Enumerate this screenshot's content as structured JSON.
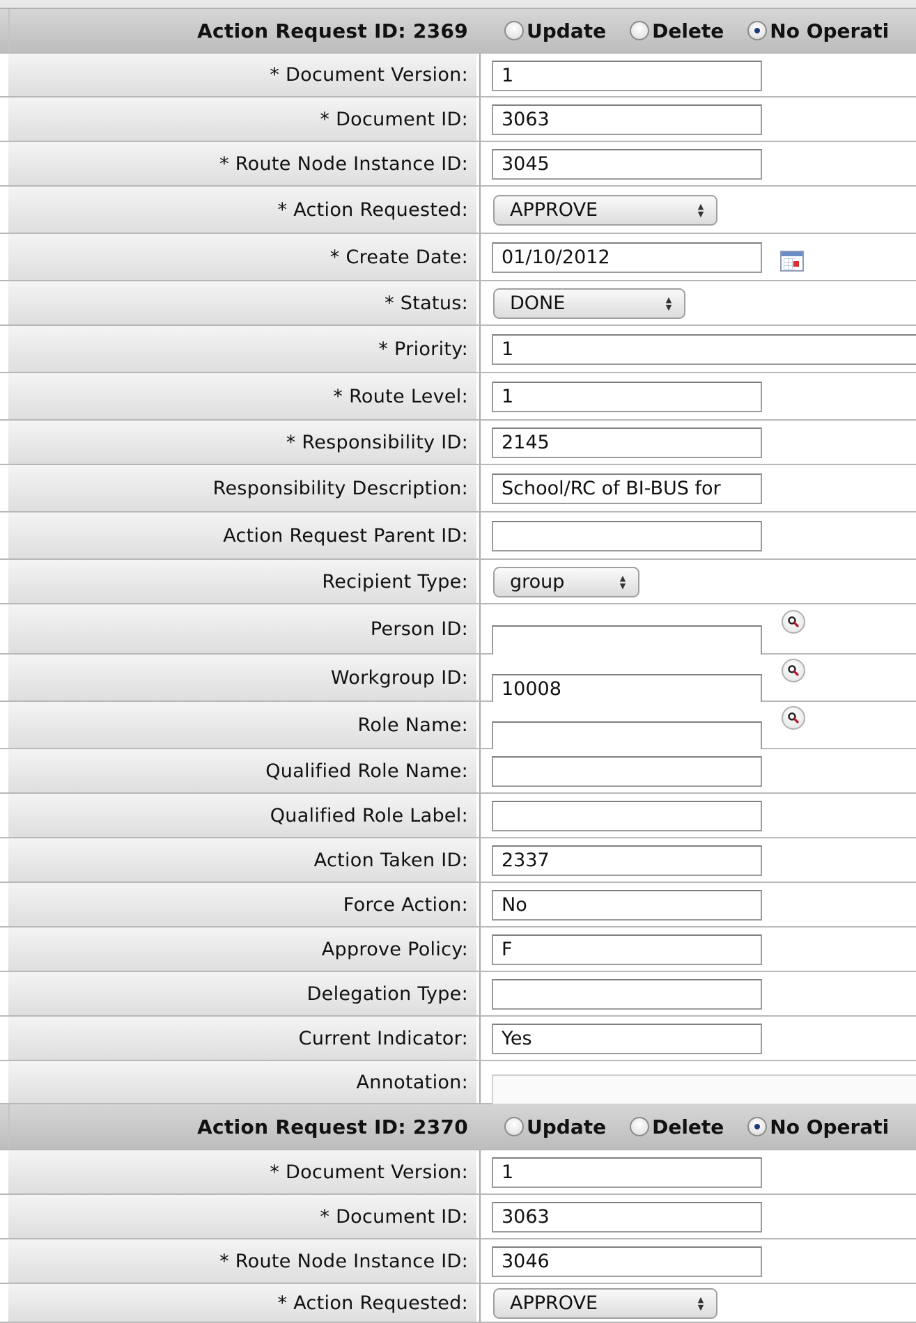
{
  "blocks": [
    {
      "header_label": "Action Request ID: 2369",
      "operations": [
        {
          "label": "Update",
          "checked": false
        },
        {
          "label": "Delete",
          "checked": false
        },
        {
          "label": "No Operati",
          "checked": true
        }
      ],
      "fields": [
        {
          "label": "* Document Version:",
          "type": "text",
          "value": "1"
        },
        {
          "label": "* Document ID:",
          "type": "text",
          "value": "3063"
        },
        {
          "label": "* Route Node Instance ID:",
          "type": "text",
          "value": "3045"
        },
        {
          "label": "* Action Requested:",
          "type": "select",
          "value": "APPROVE"
        },
        {
          "label": "* Create Date:",
          "type": "date",
          "value": "01/10/2012",
          "icon": "calendar-icon"
        },
        {
          "label": "* Status:",
          "type": "select",
          "value": "DONE"
        },
        {
          "label": "* Priority:",
          "type": "text-wide",
          "value": "1"
        },
        {
          "label": "* Route Level:",
          "type": "text",
          "value": "1"
        },
        {
          "label": "* Responsibility ID:",
          "type": "text",
          "value": "2145"
        },
        {
          "label": "Responsibility Description:",
          "type": "text",
          "value": "School/RC of BI-BUS for"
        },
        {
          "label": "Action Request Parent ID:",
          "type": "text",
          "value": ""
        },
        {
          "label": "Recipient Type:",
          "type": "select",
          "value": "group"
        },
        {
          "label": "Person ID:",
          "type": "lookup",
          "value": "",
          "icon": "magnifier-icon"
        },
        {
          "label": "Workgroup ID:",
          "type": "lookup",
          "value": "10008",
          "icon": "magnifier-icon"
        },
        {
          "label": "Role Name:",
          "type": "lookup",
          "value": "",
          "icon": "magnifier-icon"
        },
        {
          "label": "Qualified Role Name:",
          "type": "text",
          "value": ""
        },
        {
          "label": "Qualified Role Label:",
          "type": "text",
          "value": ""
        },
        {
          "label": "Action Taken ID:",
          "type": "text",
          "value": "2337"
        },
        {
          "label": "Force Action:",
          "type": "text",
          "value": "No"
        },
        {
          "label": "Approve Policy:",
          "type": "text",
          "value": "F"
        },
        {
          "label": "Delegation Type:",
          "type": "text",
          "value": ""
        },
        {
          "label": "Current Indicator:",
          "type": "text",
          "value": "Yes"
        },
        {
          "label": "Annotation:",
          "type": "textarea",
          "value": ""
        }
      ]
    },
    {
      "header_label": "Action Request ID: 2370",
      "operations": [
        {
          "label": "Update",
          "checked": false
        },
        {
          "label": "Delete",
          "checked": false
        },
        {
          "label": "No Operati",
          "checked": true
        }
      ],
      "fields": [
        {
          "label": "* Document Version:",
          "type": "text",
          "value": "1"
        },
        {
          "label": "* Document ID:",
          "type": "text",
          "value": "3063"
        },
        {
          "label": "* Route Node Instance ID:",
          "type": "text",
          "value": "3046"
        },
        {
          "label": "* Action Requested:",
          "type": "select",
          "value": "APPROVE"
        }
      ]
    }
  ]
}
